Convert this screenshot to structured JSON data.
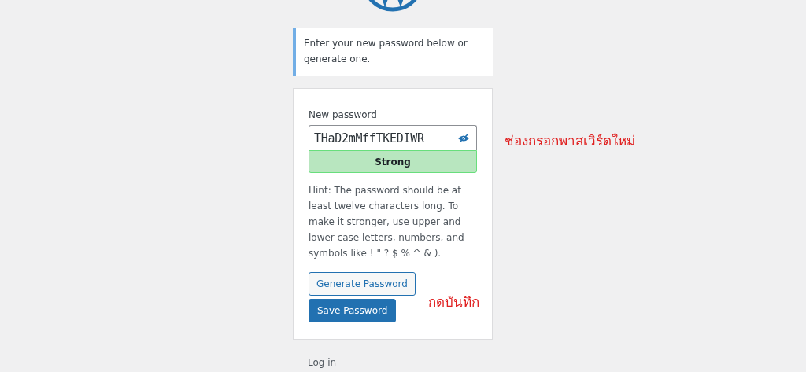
{
  "notice": "Enter your new password below or generate one.",
  "form": {
    "label": "New password",
    "value": "THaD2mMffTKEDIWR",
    "password_visible": true,
    "strength": {
      "kind": "strong",
      "label": "Strong"
    },
    "hint": "Hint: The password should be at least twelve characters long. To make it stronger, use upper and lower case letters, numbers, and symbols like ! \" ? $ % ^ & ).",
    "buttons": [
      {
        "kind": "secondary",
        "label": "Generate Password"
      },
      {
        "kind": "primary",
        "label": "Save Password"
      }
    ]
  },
  "annotations": [
    {
      "text": "ช่องกรอกพาสเวิร์ดใหม่"
    },
    {
      "text": "กดบันทึก"
    }
  ],
  "footer_link": "Log in"
}
